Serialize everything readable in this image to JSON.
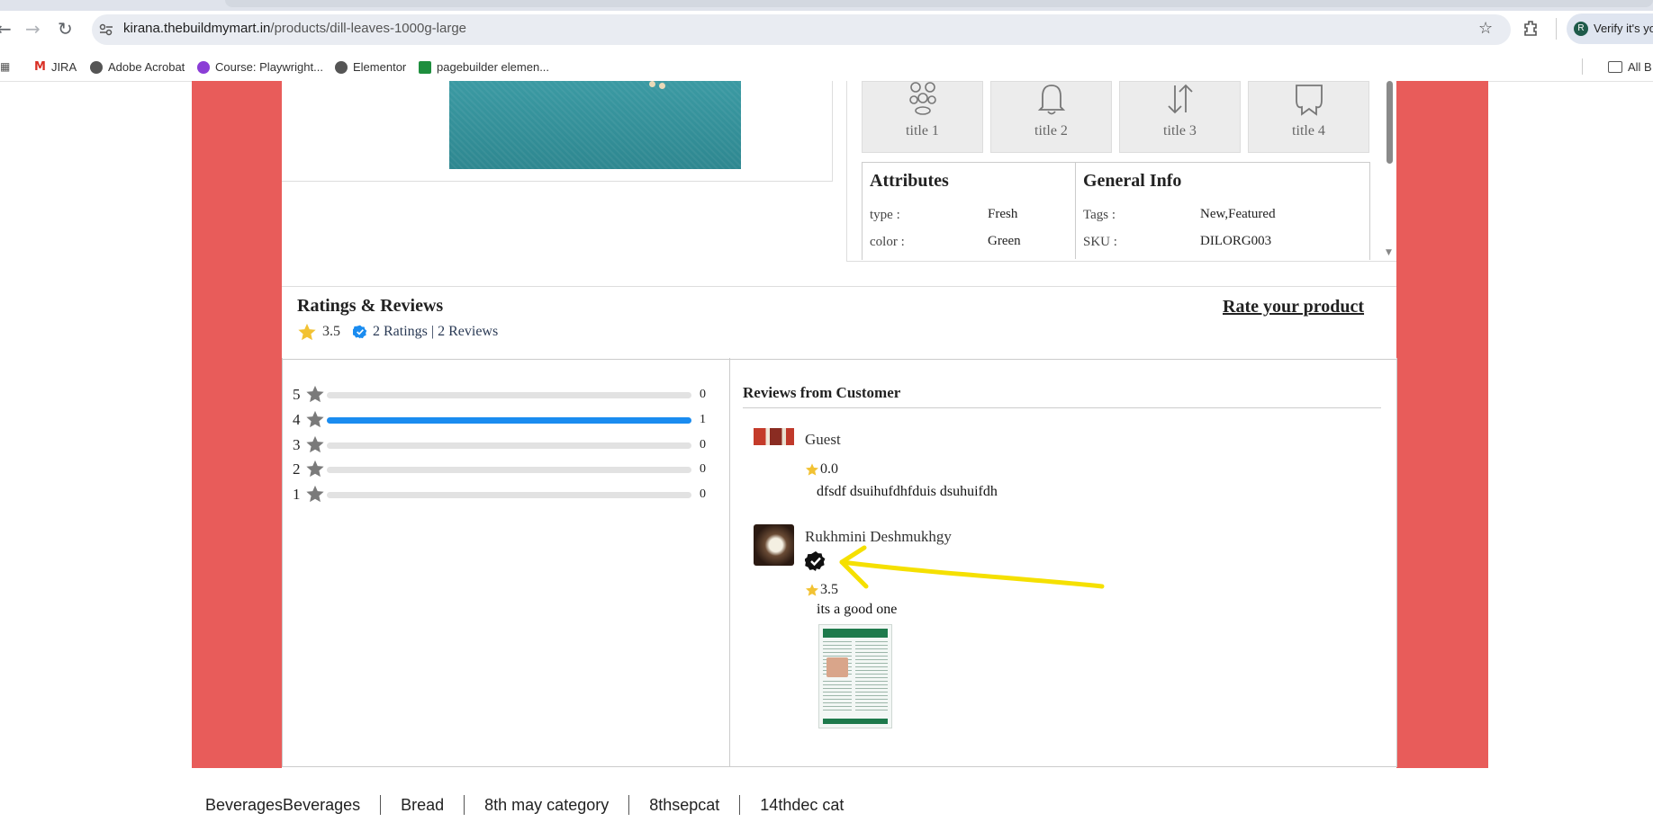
{
  "browser": {
    "url_host": "kirana.thebuildmymart.in",
    "url_path": "/products/dill-leaves-1000g-large",
    "profile_button": "Verify it's yo",
    "bookmarks": [
      "JIRA",
      "Adobe Acrobat",
      "Course: Playwright...",
      "Elementor",
      "pagebuilder elemen..."
    ],
    "all_bookmarks": "All B"
  },
  "features": [
    {
      "label": "title 1",
      "icon": "people-icon"
    },
    {
      "label": "title 2",
      "icon": "bell-icon"
    },
    {
      "label": "title 3",
      "icon": "sort-arrows-icon"
    },
    {
      "label": "title 4",
      "icon": "bookmark-icon"
    }
  ],
  "attributes": {
    "heading": "Attributes",
    "rows": [
      {
        "key": "type :",
        "value": "Fresh"
      },
      {
        "key": "color :",
        "value": "Green"
      }
    ]
  },
  "general_info": {
    "heading": "General Info",
    "rows": [
      {
        "key": "Tags :",
        "value": "New,Featured"
      },
      {
        "key": "SKU :",
        "value": "DILORG003"
      }
    ]
  },
  "ratings": {
    "title": "Ratings & Reviews",
    "average": "3.5",
    "counts": "2 Ratings | 2 Reviews",
    "rate_link": "Rate your product",
    "breakdown": [
      {
        "stars": "5",
        "count": "0",
        "fraction": 0
      },
      {
        "stars": "4",
        "count": "1",
        "fraction": 1
      },
      {
        "stars": "3",
        "count": "0",
        "fraction": 0
      },
      {
        "stars": "2",
        "count": "0",
        "fraction": 0
      },
      {
        "stars": "1",
        "count": "0",
        "fraction": 0
      }
    ]
  },
  "reviews": {
    "title": "Reviews from Customer",
    "items": [
      {
        "name": "Guest",
        "rating": "0.0",
        "text": "dfsdf dsuihufdhfduis dsuhuifdh",
        "verified": false
      },
      {
        "name": "Rukhmini Deshmukhgy",
        "rating": "3.5",
        "text": "its a good one",
        "verified": true
      }
    ]
  },
  "annotation_color": "#f5e000",
  "accent_color": "#e85c5a",
  "categories": [
    "BeveragesBeverages",
    "Bread",
    "8th may category",
    "8thsepcat",
    "14thdec cat"
  ]
}
